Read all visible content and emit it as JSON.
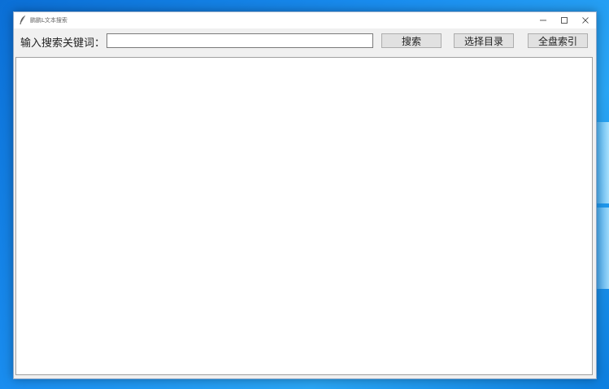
{
  "window": {
    "title": "鹏鹏L文本搜索",
    "controls": {
      "minimize_icon": "minimize-icon",
      "maximize_icon": "maximize-icon",
      "close_icon": "close-icon"
    }
  },
  "toolbar": {
    "search_label": "输入搜索关键词：",
    "search_input": {
      "value": "",
      "placeholder": ""
    },
    "search_button": "搜索",
    "select_dir_button": "选择目录",
    "full_index_button": "全盘索引"
  },
  "results": {
    "items": []
  },
  "colors": {
    "desktop": "#1a8ef0",
    "window_bg": "#f0f0f0",
    "button_bg": "#e1e1e1"
  }
}
